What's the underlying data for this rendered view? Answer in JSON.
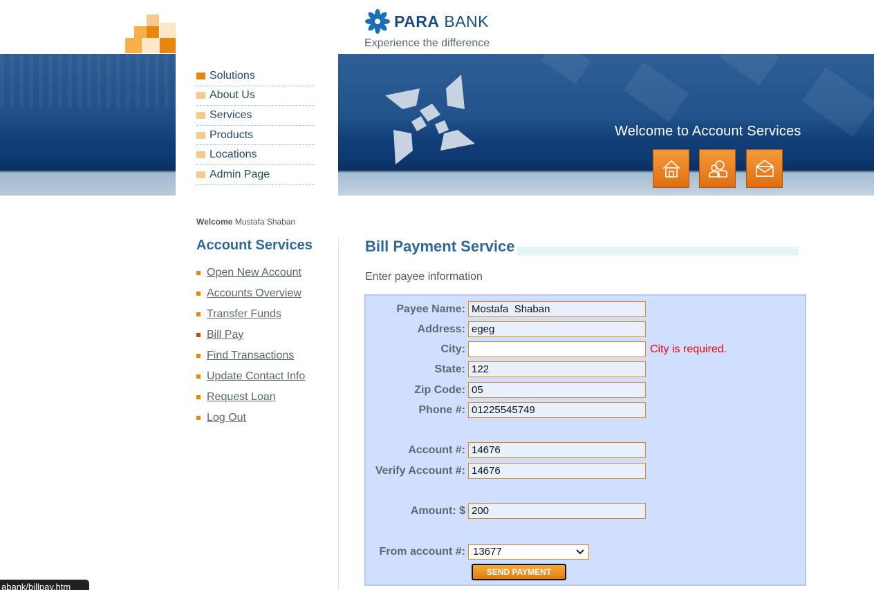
{
  "brand": {
    "name_bold": "PARA",
    "name_rest": " BANK",
    "tagline": "Experience the difference"
  },
  "banner": {
    "title": "Welcome to Account Services",
    "icons": [
      "home-icon",
      "about-icon",
      "contact-icon"
    ]
  },
  "top_nav": [
    "Solutions",
    "About Us",
    "Services",
    "Products",
    "Locations",
    "Admin Page"
  ],
  "welcome": {
    "label": "Welcome",
    "user": "Mustafa Shaban"
  },
  "account_services": {
    "heading": "Account Services",
    "links": [
      "Open New Account",
      "Accounts Overview",
      "Transfer Funds",
      "Bill Pay",
      "Find Transactions",
      "Update Contact Info",
      "Request Loan",
      "Log Out"
    ]
  },
  "main": {
    "title": "Bill Payment Service",
    "intro": "Enter payee information",
    "fields": {
      "payee_name": {
        "label": "Payee Name:",
        "value": "Mostafa  Shaban"
      },
      "address": {
        "label": "Address:",
        "value": "egeg"
      },
      "city": {
        "label": "City:",
        "value": "",
        "error": "City is required."
      },
      "state": {
        "label": "State:",
        "value": "122"
      },
      "zip": {
        "label": "Zip Code:",
        "value": "05"
      },
      "phone": {
        "label": "Phone #:",
        "value": "01225545749"
      },
      "account": {
        "label": "Account #:",
        "value": "14676"
      },
      "verify_account": {
        "label": "Verify Account #:",
        "value": "14676"
      },
      "amount": {
        "label": "Amount: $",
        "value": "200"
      },
      "from_account": {
        "label": "From account #:",
        "value": "13677"
      }
    },
    "submit_label": "SEND PAYMENT"
  },
  "status_bar": {
    "url": "abank/billpay.htm"
  },
  "colors": {
    "accent_orange": "#e8860e",
    "heading_blue": "#2f6796",
    "error_red": "#e8000b",
    "form_bg": "#d1dfff"
  }
}
